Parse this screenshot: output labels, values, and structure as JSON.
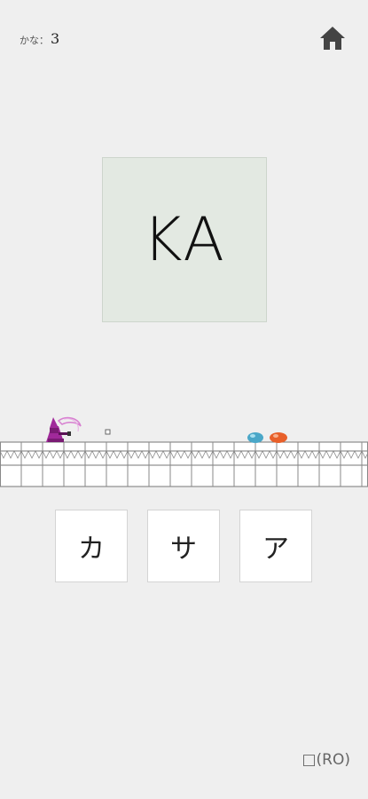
{
  "score": {
    "label": "かな：",
    "value": "3"
  },
  "prompt": {
    "romaji": "KA"
  },
  "choices": [
    {
      "kana": "カ"
    },
    {
      "kana": "サ"
    },
    {
      "kana": "ア"
    }
  ],
  "footer": {
    "note": "□(RO)"
  },
  "icons": {
    "home": "home-icon",
    "player": "wizard-sprite",
    "enemies": [
      "blue-slime",
      "orange-slime"
    ]
  },
  "colors": {
    "background": "#efefef",
    "prompt_card": "#e3e9e2",
    "wizard": "#a0299a",
    "slime_blue": "#4aa7c8",
    "slime_orange": "#e8602a"
  }
}
